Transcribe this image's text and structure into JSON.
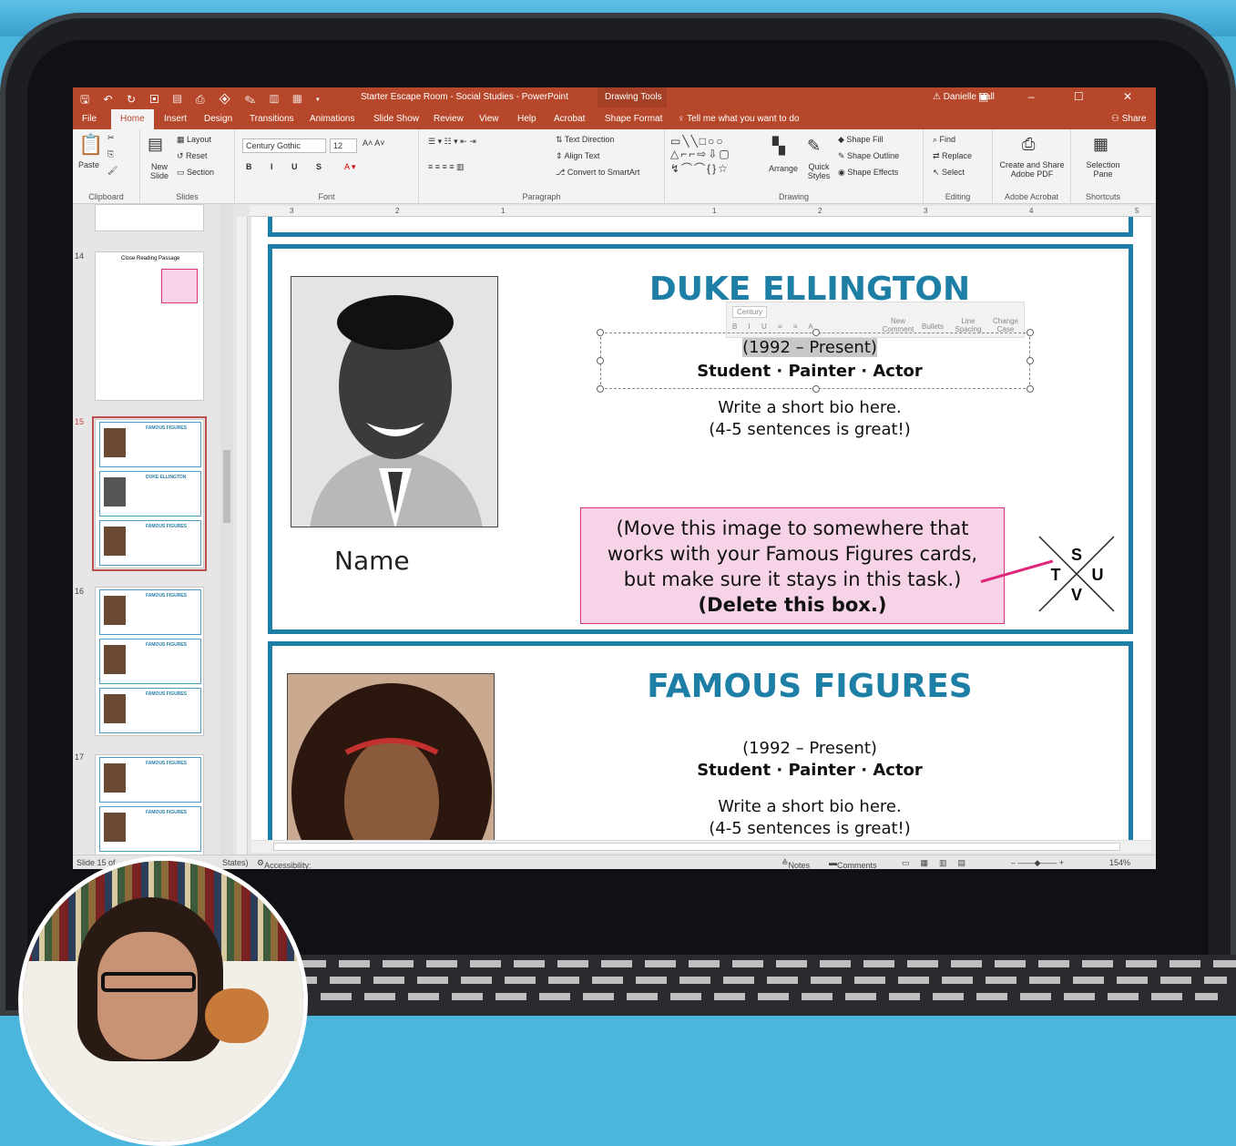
{
  "window": {
    "doc_title": "Starter Escape Room - Social Studies - PowerPoint",
    "contextual_tab": "Drawing Tools",
    "user": "Danielle Hall"
  },
  "tabs": [
    "File",
    "Home",
    "Insert",
    "Design",
    "Transitions",
    "Animations",
    "Slide Show",
    "Review",
    "View",
    "Help",
    "Acrobat",
    "Shape Format"
  ],
  "tell_me": "Tell me what you want to do",
  "share": "Share",
  "ribbon": {
    "clipboard": {
      "paste": "Paste",
      "label": "Clipboard"
    },
    "slides": {
      "new_slide": "New Slide",
      "layout": "Layout",
      "reset": "Reset",
      "section": "Section",
      "label": "Slides"
    },
    "font": {
      "family": "Century Gothic",
      "size": "12",
      "label": "Font"
    },
    "paragraph": {
      "text_direction": "Text Direction",
      "align_text": "Align Text",
      "convert": "Convert to SmartArt",
      "label": "Paragraph"
    },
    "drawing": {
      "arrange": "Arrange",
      "quick_styles": "Quick Styles",
      "shape_fill": "Shape Fill",
      "shape_outline": "Shape Outline",
      "shape_effects": "Shape Effects",
      "label": "Drawing"
    },
    "editing": {
      "find": "Find",
      "replace": "Replace",
      "select": "Select",
      "label": "Editing"
    },
    "acrobat": {
      "create": "Create and Share Adobe PDF",
      "label": "Adobe Acrobat"
    },
    "shortcuts": {
      "selection": "Selection Pane",
      "label": "Shortcuts"
    }
  },
  "thumbnails": {
    "slide14_num": "14",
    "slide14_title": "Close Reading Passage",
    "slide15_num": "15",
    "slide16_num": "16",
    "slide17_num": "17",
    "mini_title": "FAMOUS FIGURES",
    "mini_title_duke": "DUKE ELLINGTON"
  },
  "ruler": [
    "3",
    "2",
    "1",
    "1",
    "2",
    "3",
    "4",
    "5"
  ],
  "slide": {
    "card1": {
      "title": "DUKE ELLINGTON",
      "years": "(1992 – Present)",
      "roles": "Student · Painter · Actor",
      "bio1": "Write a short bio here.",
      "bio2": "(4-5 sentences is great!)",
      "name": "Name",
      "note_line1": "(Move this image to somewhere that",
      "note_line2": "works with your Famous Figures cards,",
      "note_line3": "but make sure it stays in this task.)",
      "note_line4": "(Delete this box.)",
      "compass": {
        "n": "S",
        "w": "T",
        "e": "U",
        "s": "V"
      }
    },
    "card2": {
      "title": "FAMOUS FIGURES",
      "years": "(1992 – Present)",
      "roles": "Student · Painter · Actor",
      "bio1": "Write a short bio here.",
      "bio2": "(4-5 sentences is great!)"
    },
    "minitoolbar": {
      "font": "Century",
      "new_comment": "New Comment",
      "bullets": "Bullets",
      "spacing": "Line Spacing",
      "case": "Change Case"
    }
  },
  "status": {
    "slide": "Slide 15 of",
    "states": "States)",
    "accessibility": "Accessibility: Investigate",
    "notes": "Notes",
    "comments": "Comments",
    "zoom": "154%"
  }
}
